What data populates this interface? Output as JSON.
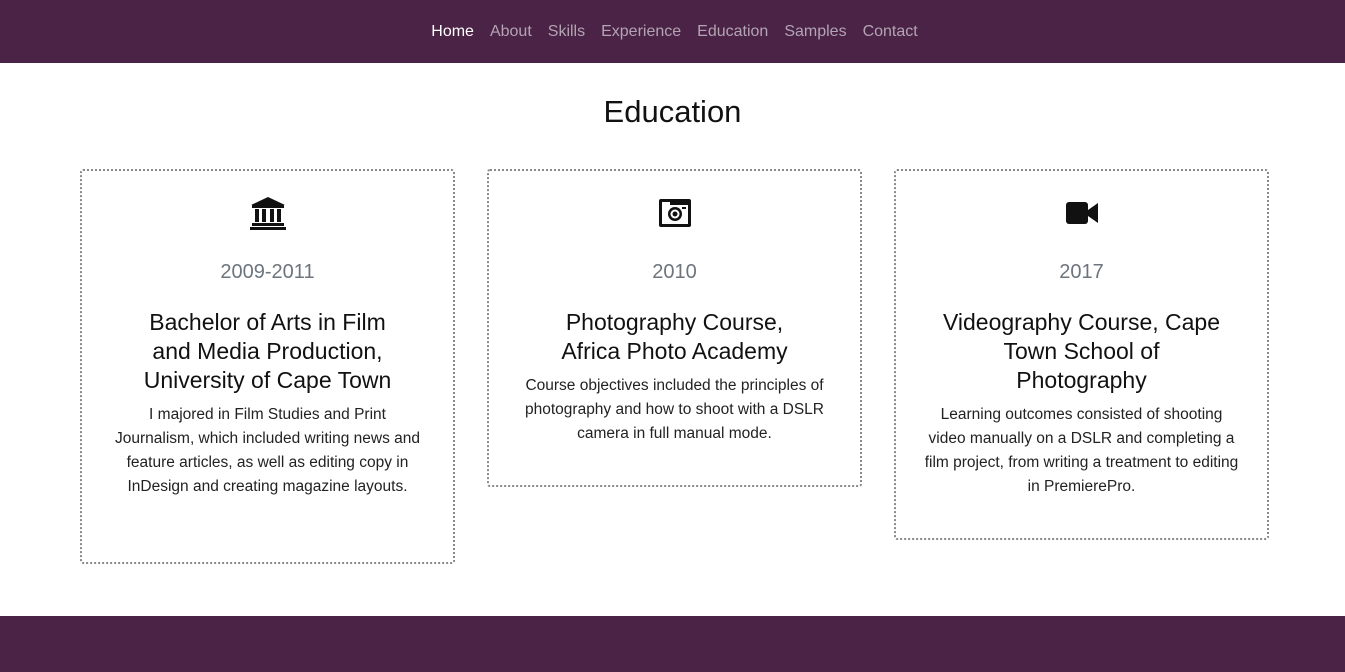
{
  "nav": {
    "items": [
      {
        "label": "Home",
        "active": true
      },
      {
        "label": "About",
        "active": false
      },
      {
        "label": "Skills",
        "active": false
      },
      {
        "label": "Experience",
        "active": false
      },
      {
        "label": "Education",
        "active": false
      },
      {
        "label": "Samples",
        "active": false
      },
      {
        "label": "Contact",
        "active": false
      }
    ]
  },
  "section": {
    "title": "Education"
  },
  "cards": [
    {
      "icon": "university-icon",
      "year": "2009-2011",
      "title": "Bachelor of Arts in Film and Media Production, University of Cape Town",
      "description": "I majored in Film Studies and Print Journalism, which included writing news and feature articles, as well as editing copy in InDesign and creating magazine layouts."
    },
    {
      "icon": "camera-icon",
      "year": "2010",
      "title": "Photography Course, Africa Photo Academy",
      "description": "Course objectives included the principles of photography and how to shoot with a DSLR camera in full manual mode."
    },
    {
      "icon": "video-camera-icon",
      "year": "2017",
      "title": "Videography Course, Cape Town School of Photography",
      "description": "Learning outcomes consisted of shooting video manually on a DSLR and completing a film project, from writing a treatment to editing in PremierePro."
    }
  ],
  "colors": {
    "brand": "#4a2346",
    "nav_inactive": "#b3a4b2",
    "nav_active": "#ffffff",
    "year_text": "#6c757d"
  }
}
